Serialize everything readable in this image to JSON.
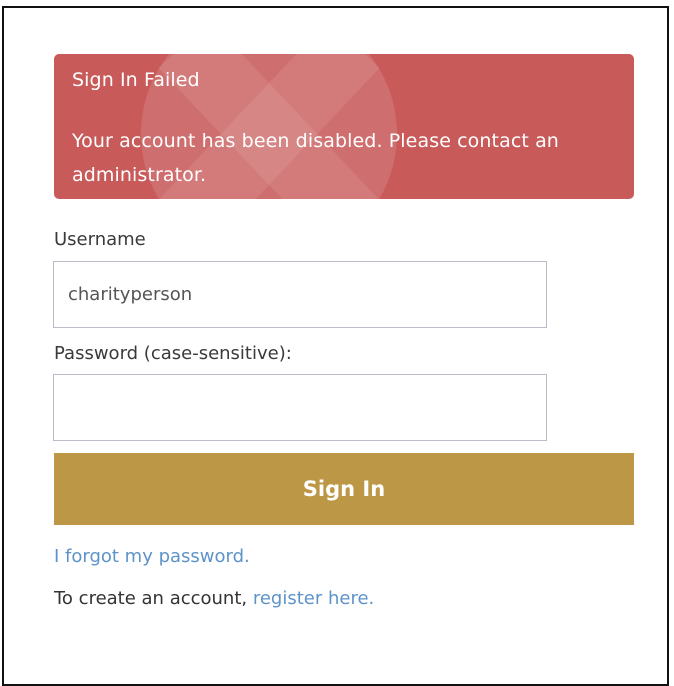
{
  "alert": {
    "title": "Sign In Failed",
    "message": "Your account has been disabled. Please contact an administrator.",
    "color": "#c95a5a",
    "decoration_icon": "x-watermark-icon"
  },
  "form": {
    "username_label": "Username",
    "username_value": "charityperson",
    "password_label": "Password (case-sensitive):",
    "password_value": "",
    "submit_label": "Sign In",
    "submit_color": "#bc9746"
  },
  "links": {
    "forgot_password": "I forgot my password.",
    "create_prefix": "To create an account, ",
    "register_link": "register here.",
    "link_color": "#5d93c9"
  }
}
